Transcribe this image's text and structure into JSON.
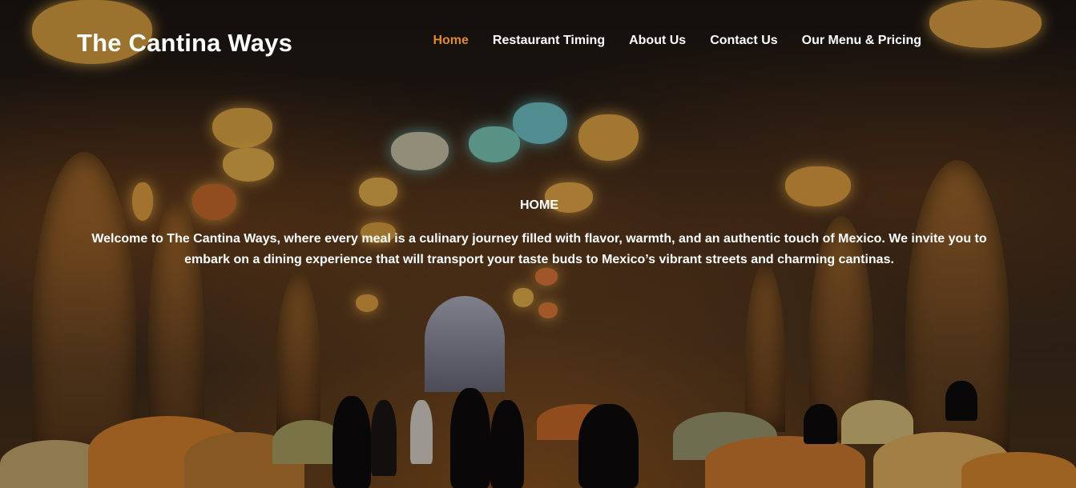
{
  "site": {
    "title": "The Cantina Ways"
  },
  "nav": {
    "items": [
      {
        "label": "Home",
        "active": true
      },
      {
        "label": "Restaurant Timing",
        "active": false
      },
      {
        "label": "About Us",
        "active": false
      },
      {
        "label": "Contact Us",
        "active": false
      },
      {
        "label": "Our Menu & Pricing",
        "active": false
      }
    ]
  },
  "hero": {
    "heading": "HOME",
    "text": "Welcome to The Cantina Ways, where every meal is a culinary journey filled with flavor, warmth, and an authentic touch of Mexico. We invite you to embark on a dining experience that will transport your taste buds to Mexico’s vibrant streets and charming cantinas."
  },
  "colors": {
    "active_nav": "#e08a2e",
    "text": "#ffffff"
  }
}
